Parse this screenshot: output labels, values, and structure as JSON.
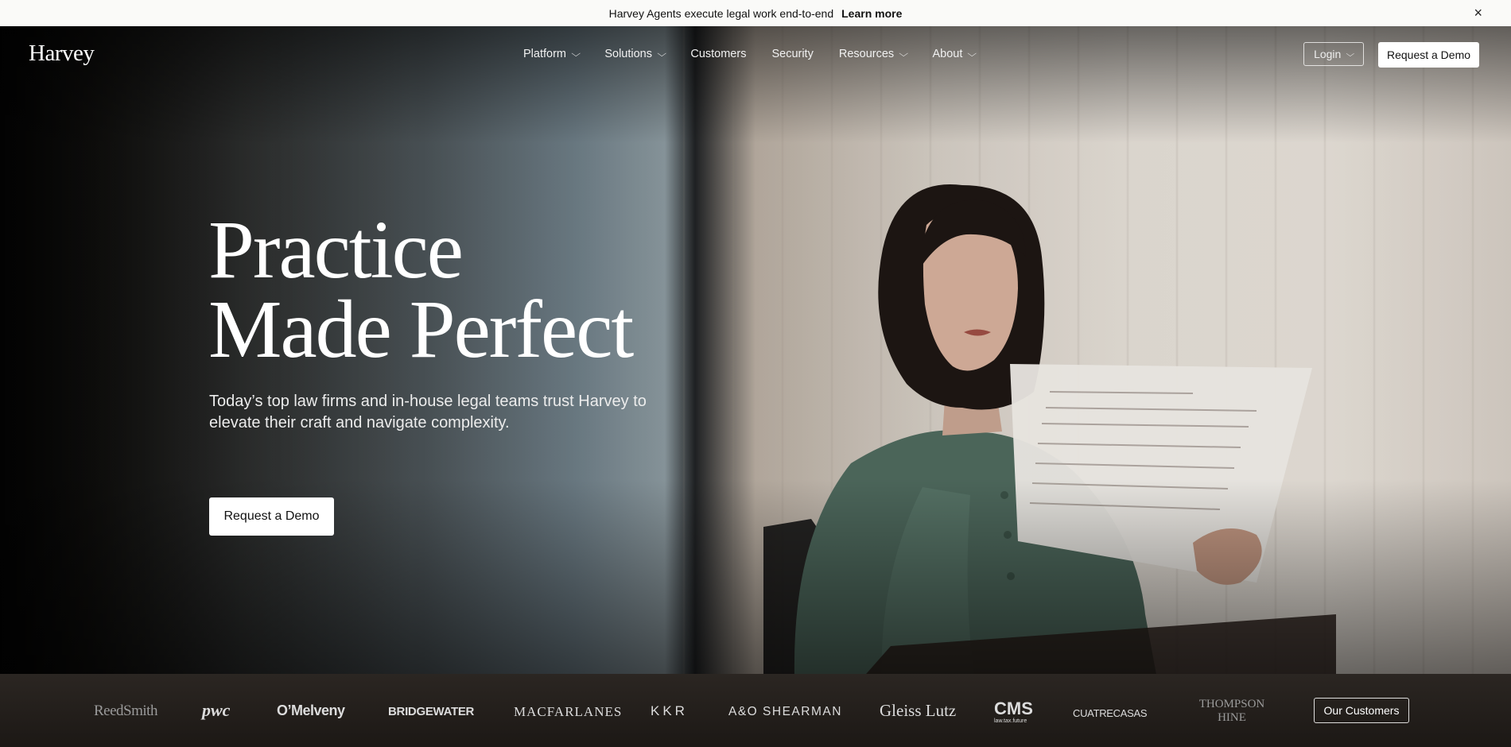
{
  "banner": {
    "message": "Harvey Agents execute legal work end-to-end",
    "link": "Learn more",
    "close_icon": "×"
  },
  "nav": {
    "logo": "Harvey",
    "items": [
      {
        "label": "Platform",
        "has_menu": true
      },
      {
        "label": "Solutions",
        "has_menu": true
      },
      {
        "label": "Customers",
        "has_menu": false
      },
      {
        "label": "Security",
        "has_menu": false
      },
      {
        "label": "Resources",
        "has_menu": true
      },
      {
        "label": "About",
        "has_menu": true
      }
    ],
    "login": "Login",
    "demo": "Request a Demo"
  },
  "hero": {
    "line1": "Practice",
    "line2": "Made Perfect",
    "subtitle": "Today’s top law firms and in-house legal teams trust Harvey to elevate their craft and navigate complexity.",
    "cta": "Request a Demo"
  },
  "customers": {
    "logos": [
      "ReedSmith",
      "pwc",
      "O’Melveny",
      "BRIDGEWATER",
      "MACFARLANES",
      "KKR",
      "A&O SHEARMAN",
      "Gleiss Lutz",
      "CMS",
      "CUATRECASAS",
      "THOMPSON HINE"
    ],
    "cms_tagline": "law.tax.future",
    "button": "Our Customers"
  }
}
